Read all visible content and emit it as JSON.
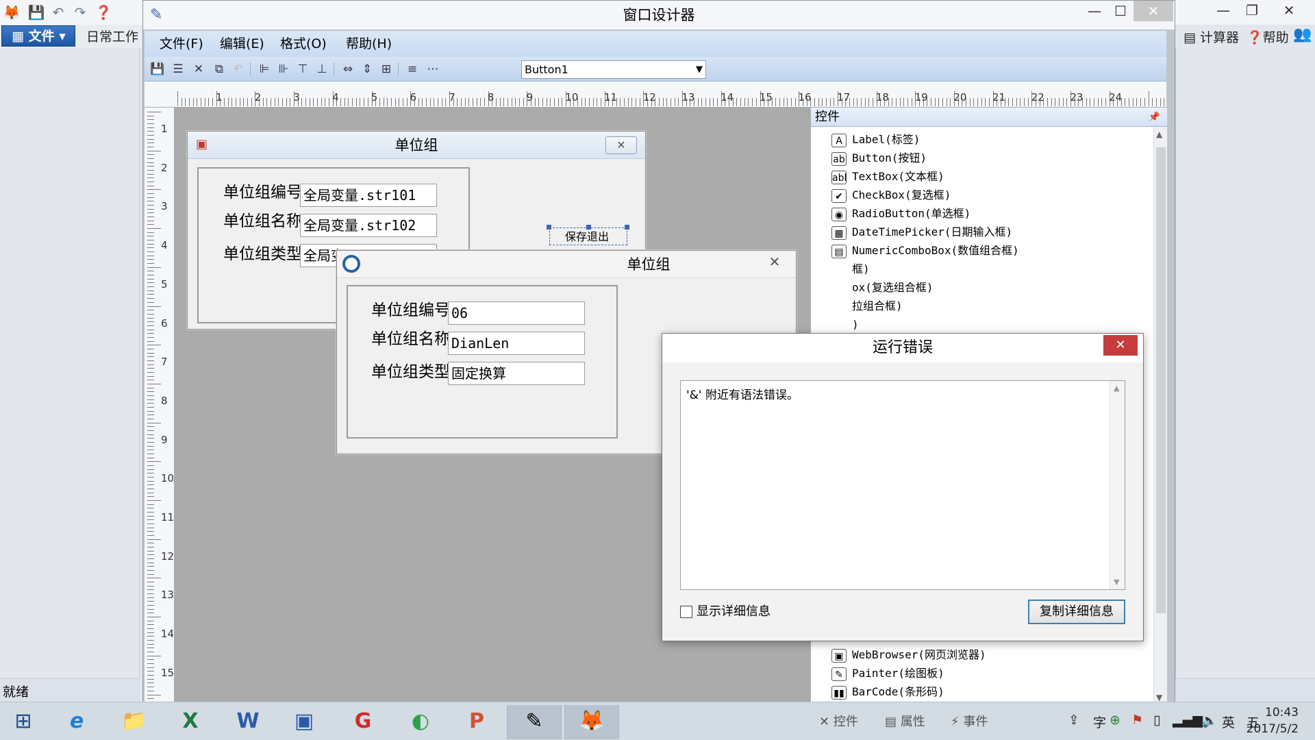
{
  "outer": {
    "file_button": "文件",
    "daily_work": "日常工作",
    "calc": "计算器",
    "help": "帮助",
    "status": "就绪",
    "ctrl_min": "—",
    "ctrl_max": "❐",
    "ctrl_close": "✕"
  },
  "designer": {
    "title": "窗口设计器",
    "menu": {
      "file": "文件(F)",
      "edit": "编辑(E)",
      "format": "格式(O)",
      "help": "帮助(H)"
    },
    "object_select": "Button1",
    "ctrl_min": "—",
    "ctrl_max": "☐",
    "ctrl_close": "✕"
  },
  "ruler": {
    "h": [
      "1",
      "2",
      "3",
      "4",
      "5",
      "6",
      "7",
      "8",
      "9",
      "10",
      "11",
      "12",
      "13",
      "14",
      "15",
      "16",
      "17",
      "18",
      "19",
      "20",
      "21",
      "22",
      "23",
      "24"
    ],
    "v": [
      "1",
      "2",
      "3",
      "4",
      "5",
      "6",
      "7",
      "8",
      "9",
      "10",
      "11",
      "12",
      "13",
      "14",
      "15"
    ]
  },
  "design_form": {
    "title": "单位组",
    "labels": [
      "单位组编号",
      "单位组名称",
      "单位组类型"
    ],
    "values": [
      "全局变量.str101",
      "全局变量.str102",
      "全局变"
    ],
    "save_exit_partial": "保存退出"
  },
  "runtime_form": {
    "title": "单位组",
    "labels": [
      "单位组编号",
      "单位组名称",
      "单位组类型"
    ],
    "values": [
      "06",
      "DianLen",
      "固定换算"
    ]
  },
  "controls_panel": {
    "title": "控件",
    "items": [
      {
        "icon": "A",
        "label": "Label(标签)"
      },
      {
        "icon": "ab",
        "label": "Button(按钮)"
      },
      {
        "icon": "abl",
        "label": "TextBox(文本框)"
      },
      {
        "icon": "✔",
        "label": "CheckBox(复选框)"
      },
      {
        "icon": "◉",
        "label": "RadioButton(单选框)"
      },
      {
        "icon": "▦",
        "label": "DateTimePicker(日期输入框)"
      },
      {
        "icon": "▤",
        "label": "NumericComboBox(数值组合框)"
      },
      {
        "icon": "",
        "label": "框)"
      },
      {
        "icon": "",
        "label": "ox(复选组合框)"
      },
      {
        "icon": "",
        "label": "拉组合框)"
      },
      {
        "icon": "",
        "label": ")"
      }
    ],
    "bottom_items": [
      {
        "icon": "▣",
        "label": "WebBrowser(网页浏览器)"
      },
      {
        "icon": "✎",
        "label": "Painter(绘图板)"
      },
      {
        "icon": "▮▮",
        "label": "BarCode(条形码)"
      }
    ],
    "tabs": [
      "控件",
      "属性",
      "事件"
    ]
  },
  "error_dialog": {
    "title": "运行错误",
    "message": "'&' 附近有语法错误。",
    "show_detail": "显示详细信息",
    "copy_button": "复制详细信息"
  },
  "tray": {
    "ime_lang": "英",
    "ime_mode": "五",
    "ime_char": "字",
    "time": "10:43",
    "date": "2017/5/2"
  }
}
